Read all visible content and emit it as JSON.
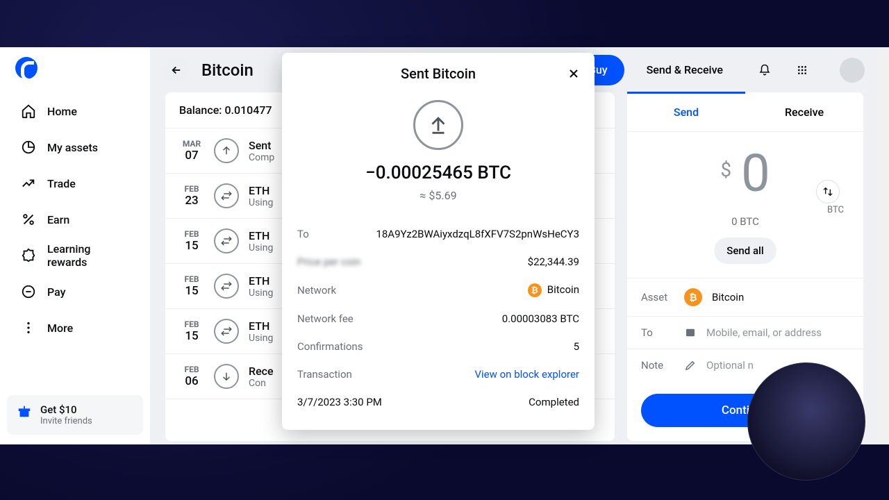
{
  "sidebar": {
    "items": [
      {
        "label": "Home"
      },
      {
        "label": "My assets"
      },
      {
        "label": "Trade"
      },
      {
        "label": "Earn"
      },
      {
        "label": "Learning rewards"
      },
      {
        "label": "Pay"
      },
      {
        "label": "More"
      }
    ],
    "referral": {
      "headline": "Get $10",
      "sub": "Invite friends"
    }
  },
  "header": {
    "title": "Bitcoin",
    "buy": "Buy",
    "send_receive": "Send & Receive"
  },
  "balance_label": "Balance: 0.010477",
  "transactions": [
    {
      "month": "MAR",
      "day": "07",
      "icon": "send",
      "line1": "Sent",
      "line2": "Comp"
    },
    {
      "month": "FEB",
      "day": "23",
      "icon": "convert",
      "line1": "ETH",
      "line2": "Using"
    },
    {
      "month": "FEB",
      "day": "15",
      "icon": "convert",
      "line1": "ETH",
      "line2": "Using"
    },
    {
      "month": "FEB",
      "day": "15",
      "icon": "convert",
      "line1": "ETH",
      "line2": "Using"
    },
    {
      "month": "FEB",
      "day": "15",
      "icon": "convert",
      "line1": "ETH",
      "line2": "Using"
    },
    {
      "month": "FEB",
      "day": "06",
      "icon": "receive",
      "line1": "Rece",
      "line2": "Con"
    }
  ],
  "send_panel": {
    "tabs": {
      "send": "Send",
      "receive": "Receive"
    },
    "currency_sup": "$",
    "amount": "0",
    "unit": "BTC",
    "sub_amount": "0 BTC",
    "send_all": "Send all",
    "asset_label": "Asset",
    "asset_value": "Bitcoin",
    "to_label": "To",
    "to_placeholder": "Mobile, email, or address",
    "note_label": "Note",
    "note_placeholder": "Optional n",
    "continue": "Continue"
  },
  "modal": {
    "title": "Sent Bitcoin",
    "amount": "−0.00025465 BTC",
    "approx": "≈ $5.69",
    "rows": {
      "to": {
        "k": "To",
        "v": "18A9Yz2BWAiyxdzqL8fXFV7S2pnWsHeCY3"
      },
      "price": {
        "k": "Price per coin",
        "v": "$22,344.39"
      },
      "network": {
        "k": "Network",
        "v": "Bitcoin"
      },
      "fee": {
        "k": "Network fee",
        "v": "0.00003083 BTC"
      },
      "confirmations": {
        "k": "Confirmations",
        "v": "5"
      },
      "tx": {
        "k": "Transaction",
        "v": "View on block explorer"
      },
      "time": {
        "k": "3/7/2023 3:30 PM",
        "v": "Completed"
      }
    }
  }
}
